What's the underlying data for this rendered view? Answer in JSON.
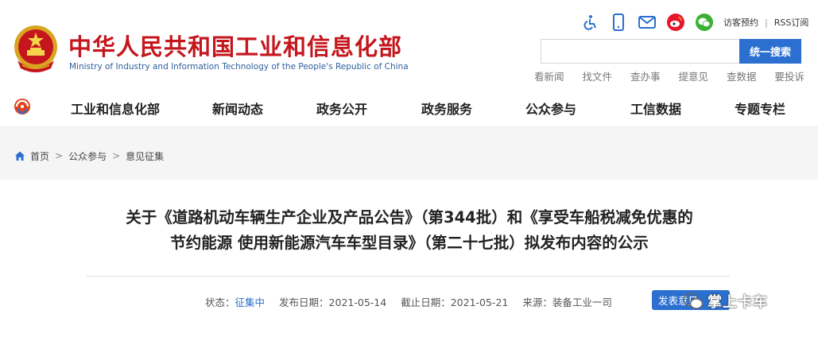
{
  "header": {
    "title": "中华人民共和国工业和信息化部",
    "subtitle": "Ministry of Industry and Information Technology of the People's Republic of China",
    "toolbar": {
      "icons": [
        "accessibility-icon",
        "mobile-icon",
        "mail-icon",
        "weibo-icon",
        "wechat-icon"
      ],
      "visitor_label": "访客预约",
      "separator": "|",
      "rss_label": "RSS订阅"
    },
    "search": {
      "placeholder": "",
      "button_label": "统一搜索"
    },
    "quick_links": [
      "看新闻",
      "找文件",
      "查办事",
      "提意见",
      "查数据",
      "要投诉"
    ]
  },
  "nav": {
    "items": [
      "工业和信息化部",
      "新闻动态",
      "政务公开",
      "政务服务",
      "公众参与",
      "工信数据",
      "专题专栏"
    ]
  },
  "breadcrumb": {
    "items": [
      "首页",
      "公众参与",
      "意见征集"
    ],
    "separator": ">"
  },
  "article": {
    "title_line1": "关于《道路机动车辆生产企业及产品公告》（第344批）和《享受车船税减免优惠的",
    "title_line2": "节约能源 使用新能源汽车车型目录》（第二十七批）拟发布内容的公示",
    "meta": {
      "status_label": "状态：",
      "status_value": "征集中",
      "publish_label": "发布日期：",
      "publish_date": "2021-05-14",
      "deadline_label": "截止日期：",
      "deadline_date": "2021-05-21",
      "source_label": "来源：",
      "source_value": "装备工业一司"
    },
    "send_button": "发表意见"
  },
  "watermark": {
    "text": "掌上卡车"
  },
  "colors": {
    "brand_red": "#c4161c",
    "accent_blue": "#2b6fd0",
    "band_gray": "#f5f5f5"
  }
}
